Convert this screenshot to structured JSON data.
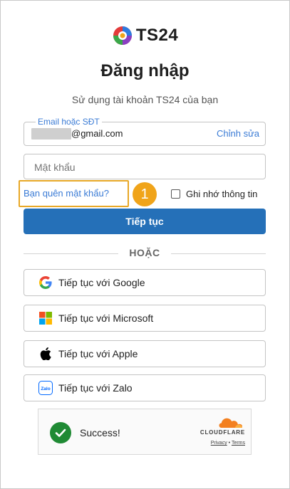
{
  "brand": {
    "logo_text": "TS24"
  },
  "login": {
    "title": "Đăng nhập",
    "subtitle": "Sử dụng tài khoản TS24 của bạn",
    "email_label": "Email hoặc SĐT",
    "email_value": "@gmail.com",
    "edit_label": "Chỉnh sửa",
    "password_placeholder": "Mật khẩu",
    "forgot_label": "Bạn quên mật khẩu?",
    "step_badge": "1",
    "remember_label": "Ghi nhớ thông tin",
    "continue_label": "Tiếp tục",
    "or_label": "HOẶC"
  },
  "social": {
    "google_label": "Tiếp tục với Google",
    "microsoft_label": "Tiếp tục với Microsoft",
    "apple_label": "Tiếp tục với Apple",
    "zalo_label": "Tiếp tục với Zalo",
    "zalo_icon_text": "Zalo"
  },
  "captcha": {
    "status": "Success!",
    "brand": "CLOUDFLARE",
    "privacy": "Privacy",
    "separator": "•",
    "terms": "Terms"
  },
  "icons": {
    "logo": "ts24-logo-icon",
    "google": "google-icon",
    "microsoft": "microsoft-icon",
    "apple": "apple-icon",
    "zalo": "zalo-icon",
    "check": "check-icon",
    "cloud": "cloudflare-cloud-icon"
  },
  "colors": {
    "primary": "#2570b8",
    "link": "#3a7bd5",
    "highlight": "#e8a826",
    "badge": "#f0a41a",
    "success": "#1f8a34",
    "cloudflare": "#f38020"
  }
}
